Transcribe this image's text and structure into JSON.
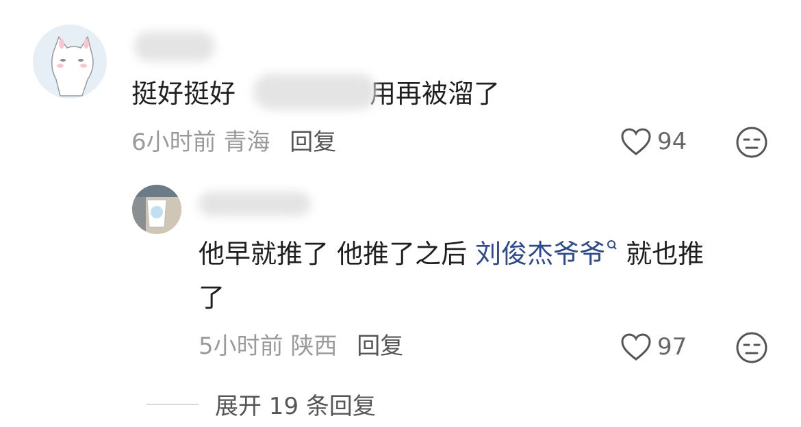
{
  "comments": [
    {
      "text_before": "挺好挺好",
      "text_after": "用再被溜了",
      "time": "6小时前",
      "location": "青海",
      "reply_label": "回复",
      "likes": "94",
      "avatar_icon": "cat-avatar"
    },
    {
      "text_line1_a": "他早就推了 他推了之后 ",
      "mention": "刘俊杰爷爷",
      "text_line1_b": " 就也推",
      "text_line2": "了",
      "time": "5小时前",
      "location": "陕西",
      "reply_label": "回复",
      "likes": "97",
      "avatar_icon": "cup-avatar"
    }
  ],
  "expand_replies": "展开 19 条回复",
  "colors": {
    "mention": "#2c4a8c",
    "meta": "#9a9a9a",
    "text": "#1f1f1f"
  }
}
